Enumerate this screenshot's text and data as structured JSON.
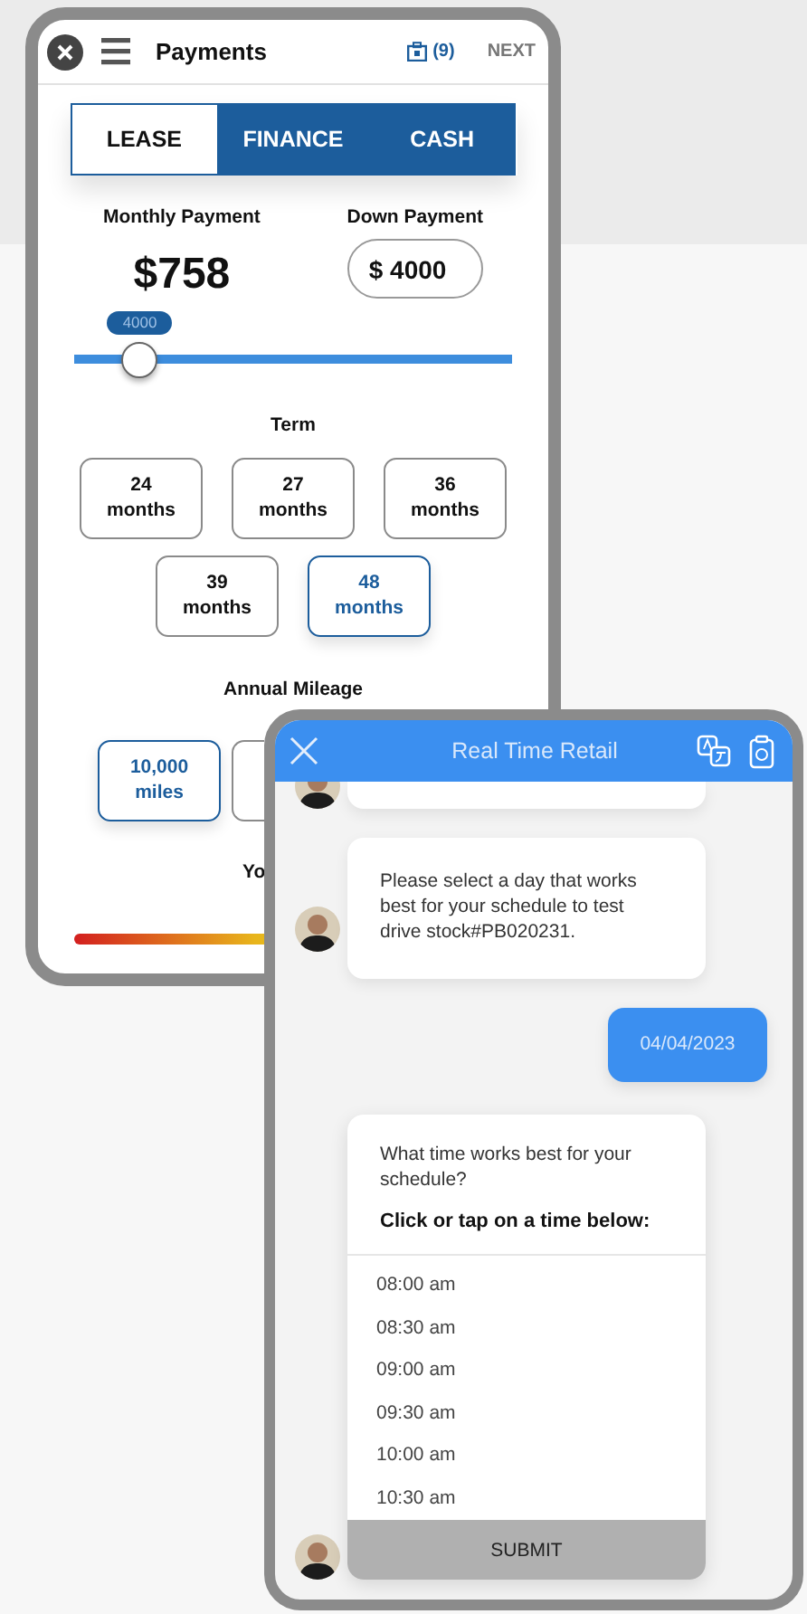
{
  "payments": {
    "title": "Payments",
    "cart_count": "(9)",
    "next": "NEXT",
    "tabs": [
      {
        "label": "LEASE",
        "selected": true
      },
      {
        "label": "FINANCE",
        "selected": false
      },
      {
        "label": "CASH",
        "selected": false
      }
    ],
    "monthly_label": "Monthly Payment",
    "monthly_value": "$758",
    "down_label": "Down Payment",
    "down_value": "$ 4000",
    "slider": {
      "bubble": "4000",
      "level": 0.15
    },
    "term_label": "Term",
    "terms": [
      {
        "number": "24",
        "unit": "months",
        "selected": false
      },
      {
        "number": "27",
        "unit": "months",
        "selected": false
      },
      {
        "number": "36",
        "unit": "months",
        "selected": false
      },
      {
        "number": "39",
        "unit": "months",
        "selected": false
      },
      {
        "number": "48",
        "unit": "months",
        "selected": true
      }
    ],
    "mileage_label": "Annual Mileage",
    "mileage": [
      {
        "number": "10,000",
        "unit": "miles",
        "selected": true
      }
    ],
    "cut_heading": "Yo"
  },
  "chat": {
    "title": "Real Time Retail",
    "messages": [
      {
        "kind": "agent-cut"
      },
      {
        "kind": "agent",
        "text": "Please select a day that works best for your schedule to test drive stock#PB020231."
      },
      {
        "kind": "user",
        "text": "04/04/2023"
      },
      {
        "kind": "time-picker",
        "question": "What time works best for your schedule?",
        "instruction": "Click or tap on a time below:",
        "times": [
          "08:00 am",
          "08:30 am",
          "09:00 am",
          "09:30 am",
          "10:00 am",
          "10:30 am"
        ],
        "submit": "SUBMIT"
      }
    ]
  }
}
